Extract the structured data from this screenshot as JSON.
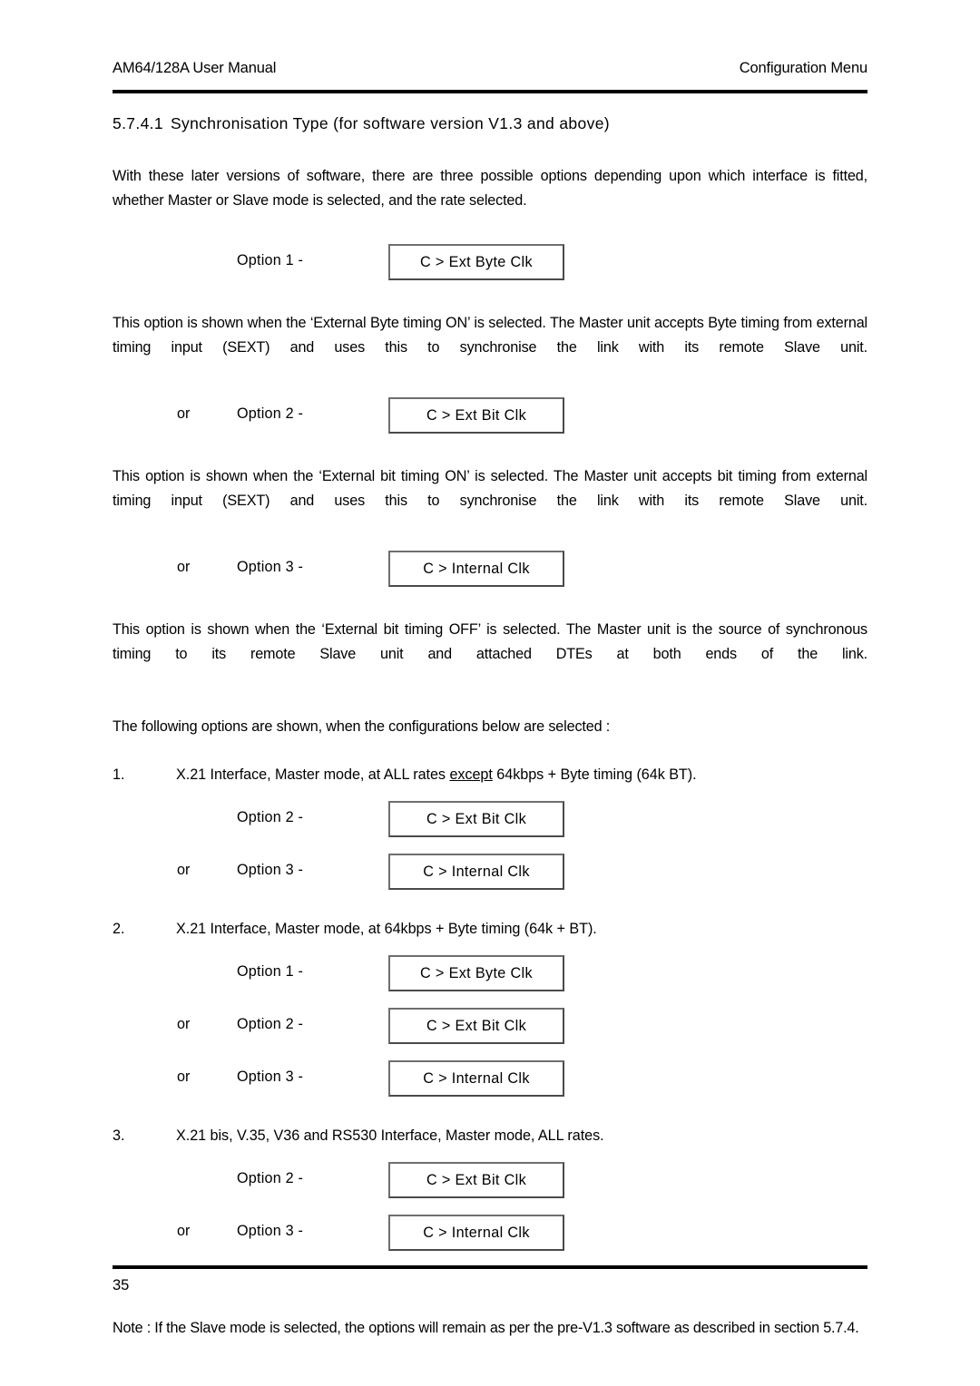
{
  "document": {
    "header": {
      "left": "AM64/128A User Manual",
      "right": "Configuration Menu"
    },
    "footer": {
      "page_number": "35"
    },
    "heading": {
      "number": "5.7.4.1",
      "title": "Synchronisation Type (for software version V1.3 and above)"
    },
    "intro_paragraph": "With these later versions of software, there are three possible options depending upon which interface is fitted, whether Master or Slave mode is selected, and the rate selected.",
    "option_1": {
      "or": "",
      "label": "Option 1 -",
      "box": "C > Ext Byte Clk"
    },
    "paragraph_byte": "This option is shown when the ‘External Byte timing ON’ is selected. The Master unit accepts Byte timing from external timing input (SEXT) and uses this to synchronise the link with its remote Slave unit.",
    "option_2": {
      "or": "or",
      "label": "Option 2 -",
      "box": "C > Ext Bit Clk"
    },
    "paragraph_bit": "This option is shown when the ‘External bit timing ON’ is selected. The Master unit accepts bit timing from external timing input (SEXT) and uses this to synchronise the link with its remote Slave unit.",
    "option_3": {
      "or": "or",
      "label": "Option 3 -",
      "box": "C > Internal Clk"
    },
    "paragraph_off": "This option is shown when the ‘External bit timing OFF’ is selected. The Master unit is the source of synchronous timing to its remote Slave unit and attached DTEs at both ends of the link.",
    "lead_in": "The following options are shown, when the configurations below are selected :",
    "items": [
      {
        "marker": "1.",
        "text_before": "X.21 Interface, Master mode, at ALL rates ",
        "text_underlined": "except",
        "text_after": " 64kbps + Byte timing (64k BT).",
        "options": [
          {
            "or": "",
            "label": "Option  2 -",
            "box": "C > Ext Bit Clk"
          },
          {
            "or": "or",
            "label": "Option  3 -",
            "box": "C > Internal Clk"
          }
        ]
      },
      {
        "marker": "2.",
        "text_before": "X.21 Interface, Master mode, at 64kbps + Byte timing (64k + BT).",
        "text_underlined": "",
        "text_after": "",
        "options": [
          {
            "or": "",
            "label": "Option  1 -",
            "box": "C > Ext Byte Clk"
          },
          {
            "or": "or",
            "label": "Option  2 -",
            "box": "C > Ext Bit Clk"
          },
          {
            "or": "or",
            "label": "Option  3 -",
            "box": "C > Internal Clk"
          }
        ]
      },
      {
        "marker": "3.",
        "text_before": "X.21 bis, V.35, V36 and RS530 Interface, Master mode, ALL rates.",
        "text_underlined": "",
        "text_after": "",
        "options": [
          {
            "or": "",
            "label": "Option  2 -",
            "box": "C > Ext Bit Clk"
          },
          {
            "or": "or",
            "label": "Option  3 -",
            "box": "C > Internal Clk"
          }
        ]
      }
    ],
    "note": "Note : If the Slave mode is selected, the options will remain as per the pre-V1.3 software as described in section 5.7.4."
  }
}
